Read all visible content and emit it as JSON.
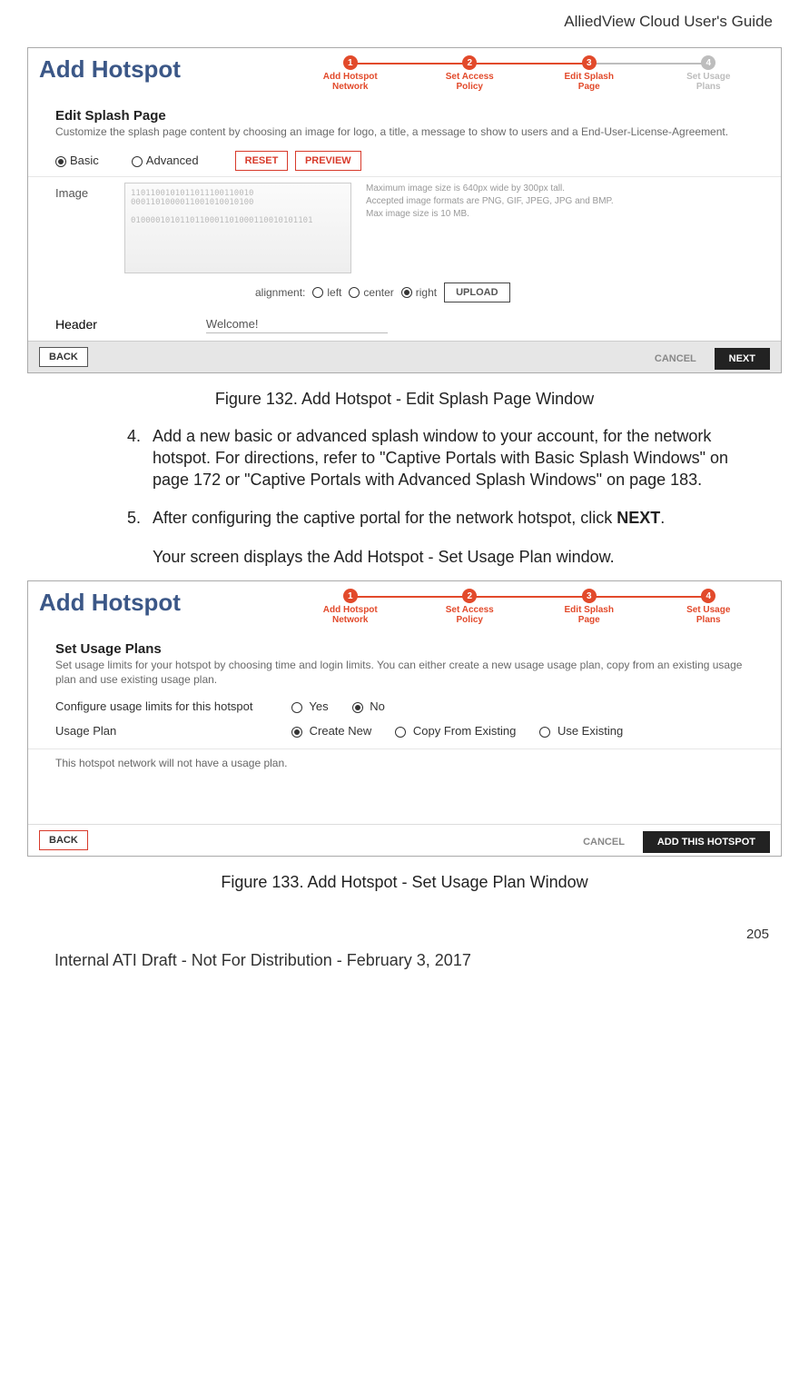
{
  "doc": {
    "header": "AlliedView Cloud User's Guide",
    "page_num": "205",
    "footer": "Internal ATI Draft - Not For Distribution - February 3, 2017"
  },
  "fig132": {
    "caption": "Figure 132. Add Hotspot - Edit Splash Page Window",
    "title": "Add Hotspot",
    "steps": [
      {
        "num": "1",
        "label_a": "Add Hotspot",
        "label_b": "Network",
        "grey": false
      },
      {
        "num": "2",
        "label_a": "Set Access",
        "label_b": "Policy",
        "grey": false
      },
      {
        "num": "3",
        "label_a": "Edit Splash",
        "label_b": "Page",
        "grey": false
      },
      {
        "num": "4",
        "label_a": "Set Usage",
        "label_b": "Plans",
        "grey": true
      }
    ],
    "section_title": "Edit Splash Page",
    "section_desc": "Customize the splash page content by choosing an image for logo, a title, a message to show to users and a End-User-License-Agreement.",
    "radio_basic": "Basic",
    "radio_advanced": "Advanced",
    "reset": "RESET",
    "preview": "PREVIEW",
    "image_label": "Image",
    "img_hint1": "Maximum image size is 640px wide by 300px tall.",
    "img_hint2": "Accepted image formats are PNG, GIF, JPEG, JPG and BMP.",
    "img_hint3": "Max image size is 10 MB.",
    "align_label": "alignment:",
    "align_left": "left",
    "align_center": "center",
    "align_right": "right",
    "upload": "UPLOAD",
    "header_label": "Header",
    "header_value": "Welcome!",
    "back": "BACK",
    "cancel": "CANCEL",
    "next": "NEXT"
  },
  "body": {
    "step4_num": "4.",
    "step4": "Add a new basic or advanced splash window to your account, for the network hotspot. For directions, refer to \"Captive Portals with Basic Splash Windows\" on page 172 or \"Captive Portals with Advanced Splash Windows\" on page 183.",
    "step5_num": "5.",
    "step5_a": "After configuring the captive portal for the network hotspot, click ",
    "step5_b": "NEXT",
    "step5_c": ".",
    "step5_p": "Your screen displays the Add Hotspot - Set Usage Plan window."
  },
  "fig133": {
    "caption": "Figure 133. Add Hotspot - Set Usage Plan Window",
    "title": "Add Hotspot",
    "steps": [
      {
        "num": "1",
        "label_a": "Add Hotspot",
        "label_b": "Network"
      },
      {
        "num": "2",
        "label_a": "Set Access",
        "label_b": "Policy"
      },
      {
        "num": "3",
        "label_a": "Edit Splash",
        "label_b": "Page"
      },
      {
        "num": "4",
        "label_a": "Set Usage",
        "label_b": "Plans"
      }
    ],
    "section_title": "Set Usage Plans",
    "section_desc": "Set usage limits for your hotspot by choosing time and login limits. You can either create a new usage usage plan, copy from an existing usage plan and use existing usage plan.",
    "cfg_label": "Configure usage limits for this hotspot",
    "cfg_yes": "Yes",
    "cfg_no": "No",
    "plan_label": "Usage Plan",
    "plan_create": "Create New",
    "plan_copy": "Copy From Existing",
    "plan_use": "Use Existing",
    "note": "This hotspot network will not have a usage plan.",
    "back": "BACK",
    "cancel": "CANCEL",
    "add": "ADD THIS HOTSPOT"
  }
}
